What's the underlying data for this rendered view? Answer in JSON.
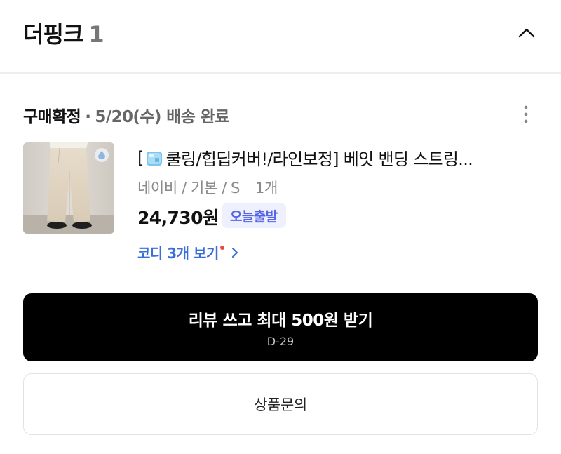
{
  "store": {
    "name": "더핑크",
    "count": "1"
  },
  "order": {
    "status": "구매확정",
    "separator": "·",
    "delivery_info": "5/20(수) 배송 완료"
  },
  "product": {
    "name_prefix": "[",
    "name_rest": "쿨링/힙딥커버!/라인보정] 베잇 밴딩 스트링...",
    "option": "네이비 / 기본 / S",
    "quantity": "1개",
    "price": "24,730원",
    "shipping_badge": "오늘출발",
    "coordi_link": "코디 3개 보기"
  },
  "actions": {
    "review_label": "리뷰 쓰고 최대 500원 받기",
    "review_deadline": "D-29",
    "inquiry_label": "상품문의"
  },
  "icons": {
    "collapse": "chevron-up-icon",
    "more": "more-vertical-icon",
    "ice": "ice-cube-emoji",
    "coordi_arrow": "chevron-right-icon",
    "thumb_badge": "water-drop-icon"
  },
  "colors": {
    "accent_blue": "#3b6fd8",
    "badge_text": "#5565e8",
    "badge_bg": "#eef1fd",
    "notification_dot": "#ee4545",
    "primary_button": "#000000"
  }
}
